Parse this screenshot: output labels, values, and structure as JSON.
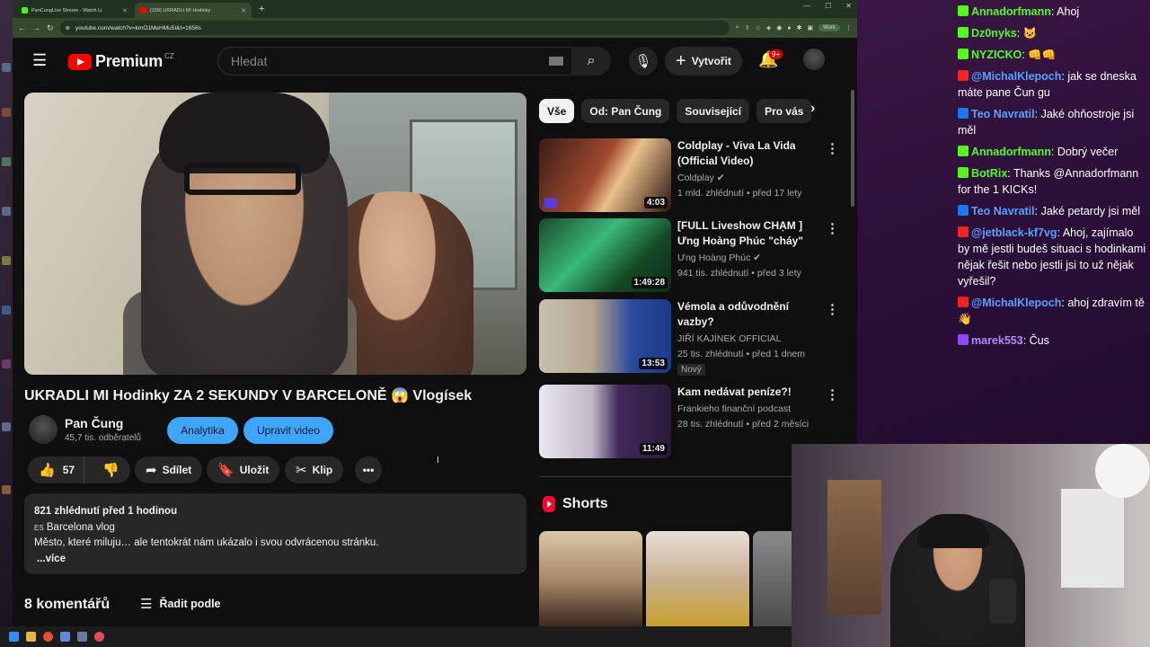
{
  "browser": {
    "tabs": [
      {
        "label": "PanCungLive Stream - Watch Li",
        "favicon_color": "#53fc18",
        "active": false
      },
      {
        "label": "(109) UKRADLI MI Hodinky",
        "favicon_color": "#ff0000",
        "active": true
      }
    ],
    "url": "youtube.com/watch?v=kmO1MeHMu5I&t=1656s",
    "profile_label": "Work"
  },
  "header": {
    "logo_text": "Premium",
    "logo_country": "CZ",
    "search_placeholder": "Hledat",
    "create_label": "Vytvořit",
    "notifications_badge": "9+"
  },
  "video": {
    "title": "UKRADLI MI Hodinky ZA 2 SEKUNDY V BARCELONĚ 😱 Vlogísek",
    "channel": "Pan Čung",
    "subscribers": "45,7 tis. odběratelů",
    "analytics_label": "Analytika",
    "edit_label": "Upravit video",
    "likes": "57",
    "share_label": "Sdílet",
    "save_label": "Uložit",
    "clip_label": "Klip",
    "views_date": "821 zhlédnutí  před 1 hodinou",
    "location_tag": "ES",
    "location": "Barcelona vlog",
    "description": "Město, které miluju… ale tentokrát nám ukázalo i svou odvrácenou stránku.",
    "more_label": "...více",
    "comments_count": "8 komentářů",
    "sort_label": "Řadit podle"
  },
  "chips": [
    "Vše",
    "Od: Pan Čung",
    "Související",
    "Pro vás"
  ],
  "recommendations": [
    {
      "title": "Coldplay - Viva La Vida (Official Video)",
      "channel": "Coldplay",
      "meta": "1 mld. zhlédnutí • před 17 lety",
      "duration": "4:03",
      "badge": ""
    },
    {
      "title": "[FULL Liveshow CHẠM ] Ưng Hoàng Phúc \"cháy\" hết...",
      "channel": "Ưng Hoàng Phúc",
      "meta": "941 tis. zhlédnutí • před 3 lety",
      "duration": "1:49:28",
      "badge": ""
    },
    {
      "title": "Vémola a odůvodnění vazby?",
      "channel": "JIŘÍ KAJÍNEK OFFICIAL",
      "meta": "25 tis. zhlédnutí • před 1 dnem",
      "duration": "13:53",
      "badge": "Nový"
    },
    {
      "title": "Kam nedávat peníze?!",
      "channel": "Frankieho finanční podcast",
      "meta": "28 tis. zhlédnutí • před 2 měsíci",
      "duration": "11:49",
      "badge": ""
    }
  ],
  "shorts_label": "Shorts",
  "chat": [
    {
      "platform": "kick",
      "user": "Annadorfmann",
      "text": "Ahoj"
    },
    {
      "platform": "kick",
      "user": "Dz0nyks",
      "text": "🐱"
    },
    {
      "platform": "kick",
      "user": "NYZICKO",
      "text": "👊👊"
    },
    {
      "platform": "youtube",
      "user": "@MichalKlepoch",
      "text": "jak se dneska máte pane Čun gu"
    },
    {
      "platform": "facebook",
      "user": "Teo Navratil",
      "text": "Jaké ohňostroje jsi měl"
    },
    {
      "platform": "kick",
      "user": "Annadorfmann",
      "text": "Dobrý večer"
    },
    {
      "platform": "kick",
      "user": "BotRix",
      "text": "Thanks @Annadorfmann for the 1 KICKs!"
    },
    {
      "platform": "facebook",
      "user": "Teo Navratil",
      "text": "Jaké petardy jsi měl"
    },
    {
      "platform": "youtube",
      "user": "@jetblack-kf7vg",
      "text": "Ahoj, zajímalo by mě jestli budeš situaci s hodinkami nějak řešit nebo jestli jsi to už nějak vyřešil?"
    },
    {
      "platform": "youtube",
      "user": "@MichalKlepoch",
      "text": "ahoj zdravím tě 👋"
    },
    {
      "platform": "twitch",
      "user": "marek553",
      "text": "Čus"
    }
  ],
  "colors": {
    "kick": "#53fc18",
    "youtube": "#ff0000",
    "facebook": "#1877f2",
    "twitch": "#9146ff",
    "accent_blue": "#3ea6ff"
  }
}
